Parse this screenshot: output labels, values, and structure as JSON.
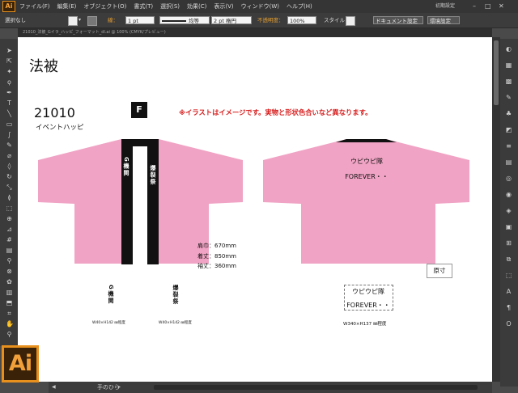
{
  "app": {
    "logo": "Ai"
  },
  "menu": [
    "ファイル(F)",
    "編集(E)",
    "オブジェクト(O)",
    "書式(T)",
    "選択(S)",
    "効果(C)",
    "表示(V)",
    "ウィンドウ(W)",
    "ヘルプ(H)"
  ],
  "workspace": "初期設定",
  "control": {
    "selection_label": "選択なし",
    "stroke_label": "線：",
    "stroke_weight": "1 pt",
    "profile_label": "均等",
    "brush": "2 pt 楕円",
    "opacity_label": "不透明度：",
    "opacity_value": "100%",
    "style_label": "スタイル：",
    "doc_settings": "ドキュメント設定",
    "env_settings": "環境設定"
  },
  "tab": {
    "label": "21010_法被_Gイラ_ハッピ_フォーマット_dl.ai @ 100% (CMYK/プレビュー)"
  },
  "doc": {
    "title": "法被",
    "code": "21010",
    "subtitle": "イベントハッピ",
    "badge": "F",
    "notice": "※イラストはイメージです。実物と形状色合いなど異なります。",
    "dims": {
      "width": "肩巾：670mm",
      "length": "着丈：850mm",
      "sleeve": "袖丈：360mm"
    },
    "scale": "原寸",
    "collar_left": "G機関",
    "collar_right": "爆裂祭",
    "back_text1": "ウピウピ隊",
    "back_text2": "FOREVER・・",
    "detail_left": "G機関",
    "detail_right": "爆裂祭",
    "size_left": "W40×H142 ㎜程度",
    "size_right": "W40×H142 ㎜程度",
    "back_detail1": "ウピウピ隊",
    "back_detail2": "FOREVER・・",
    "back_size": "W340×H137 ㎜程度"
  },
  "status": {
    "tool": "手のひら"
  },
  "colors": {
    "happi_pink": "#f0a3c4",
    "collar": "#111111",
    "notice": "#d81c1c",
    "ai_orange": "#e8901e"
  }
}
